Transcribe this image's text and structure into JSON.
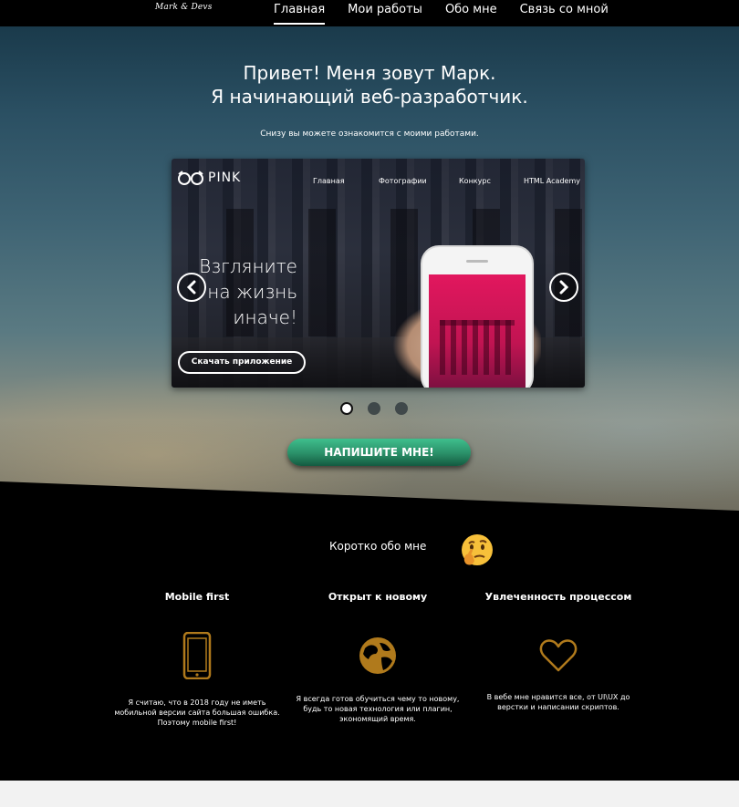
{
  "logo": "Mark & Devs",
  "nav": {
    "items": [
      {
        "label": "Главная"
      },
      {
        "label": "Мои работы"
      },
      {
        "label": "Обо мне"
      },
      {
        "label": "Связь со мной"
      }
    ],
    "active_index": 0
  },
  "hero": {
    "title_line1": "Привет! Меня зовут Марк.",
    "title_line2": "Я начинающий веб-разработчик.",
    "subtitle": "Снизу вы можете ознакомится с моими работами."
  },
  "slider": {
    "logo_text": "PINK",
    "nav": [
      "Главная",
      "Фотографии",
      "Конкурс",
      "HTML Academy"
    ],
    "headline_lines": [
      "Взгляните",
      "на жизнь",
      "иначе!"
    ],
    "button_label": "Скачать приложение",
    "icons": {
      "prev": "chevron-left-icon",
      "next": "chevron-right-icon"
    },
    "slide_count": 3,
    "active_slide": 1
  },
  "cta_label": "НАПИШИТЕ МНЕ!",
  "about": {
    "title": "Коротко обо мне",
    "emoji": "thinking-face-emoji",
    "features": [
      {
        "title": "Mobile first",
        "icon": "smartphone-icon",
        "text": "Я считаю, что в 2018 году не иметь мобильной версии сайта большая ошибка. Поэтому mobile first!"
      },
      {
        "title": "Открыт к новому",
        "icon": "globe-icon",
        "text": "Я всегда готов обучиться чему то новому, будь то новая технология или плагин, экономящий время."
      },
      {
        "title": "Увлеченность процессом",
        "icon": "heart-icon",
        "text": "В вебе мне нравится все, от UI\\UX до верстки и написании скриптов."
      }
    ],
    "accent_color": "#b07a1c"
  },
  "colors": {
    "cta_green": "#2a8f68",
    "pink": "#e2175e",
    "black": "#000000"
  }
}
